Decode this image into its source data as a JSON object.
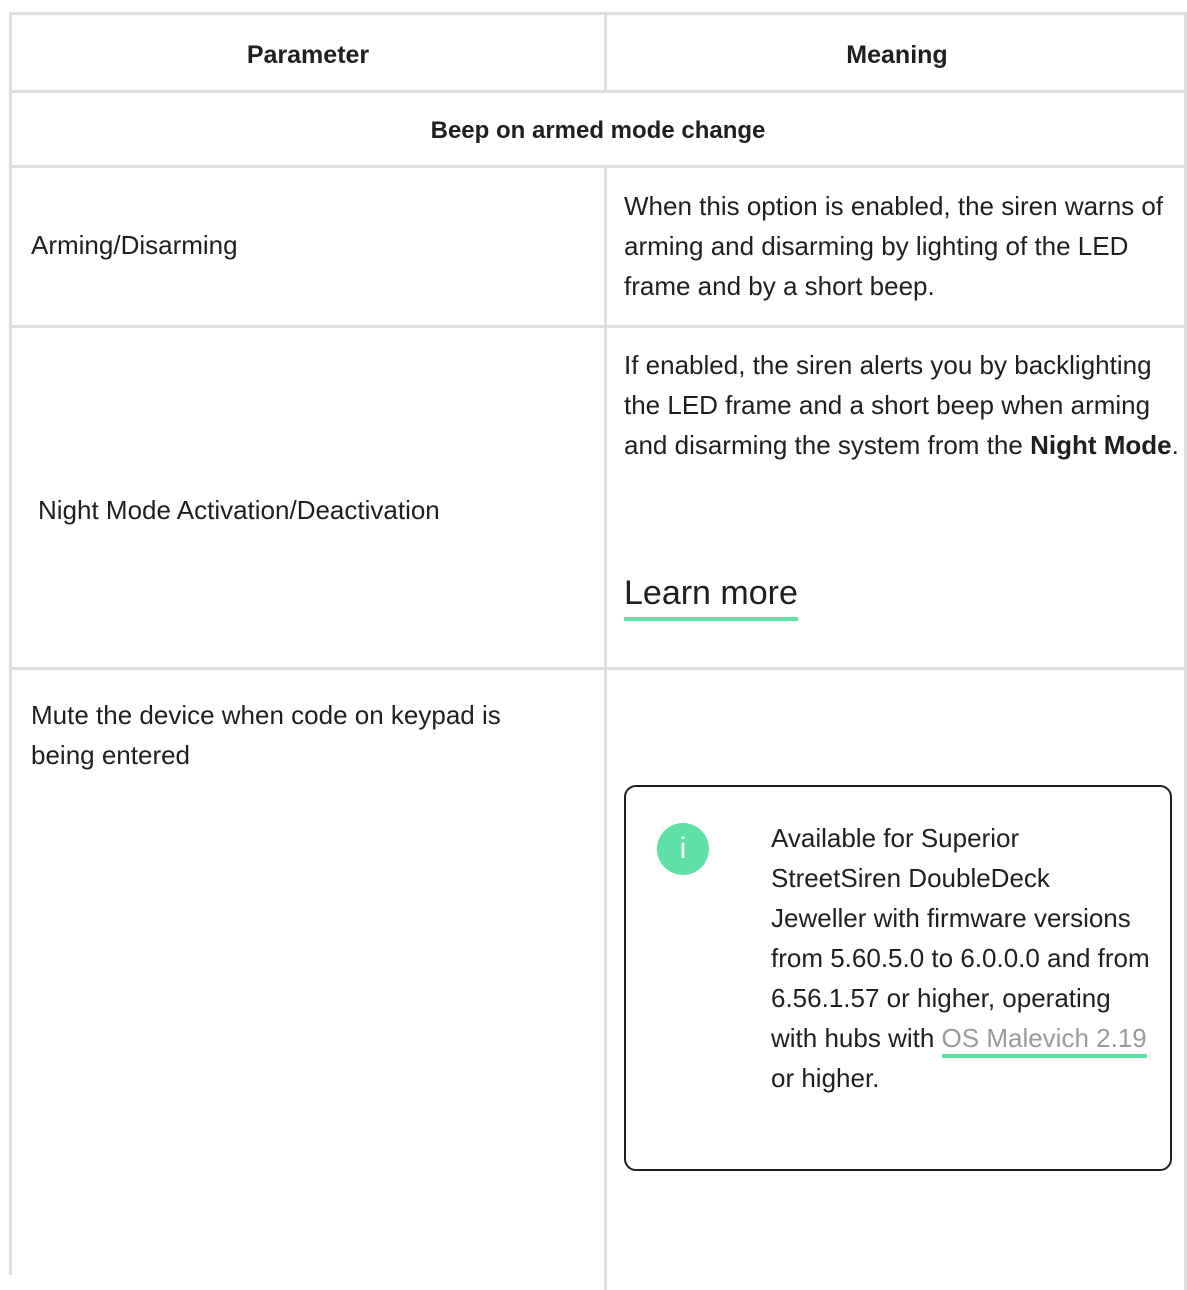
{
  "table": {
    "headers": {
      "parameter": "Parameter",
      "meaning": "Meaning"
    },
    "section_title": "Beep on armed mode change",
    "rows": [
      {
        "parameter": "Arming/Disarming",
        "meaning": "When this option is enabled, the siren warns of arming and disarming by lighting of the LED frame and by a short beep."
      },
      {
        "parameter": "Night Mode Activation/Deactivation",
        "meaning_prefix": "If enabled, the siren alerts you by backlighting the LED frame and a short beep when arming and disarming the system from the ",
        "meaning_bold": "Night Mode",
        "meaning_suffix": ".",
        "link_label": "Learn more"
      },
      {
        "parameter": "Mute the device when code on keypad is being entered",
        "note": {
          "icon": "info-icon",
          "icon_glyph": "i",
          "text_prefix": "Available for Superior StreetSiren DoubleDeck Jeweller with firmware versions from 5.60.5.0 to 6.0.0.0 and from 6.56.1.57 or higher, operating with hubs with ",
          "link_label": "OS Malevich 2.19",
          "text_suffix": " or higher."
        }
      }
    ]
  },
  "colors": {
    "accent": "#5fe0a6",
    "border": "#dedede",
    "text": "#1f1f1f",
    "link_muted": "#9a9a9a"
  }
}
